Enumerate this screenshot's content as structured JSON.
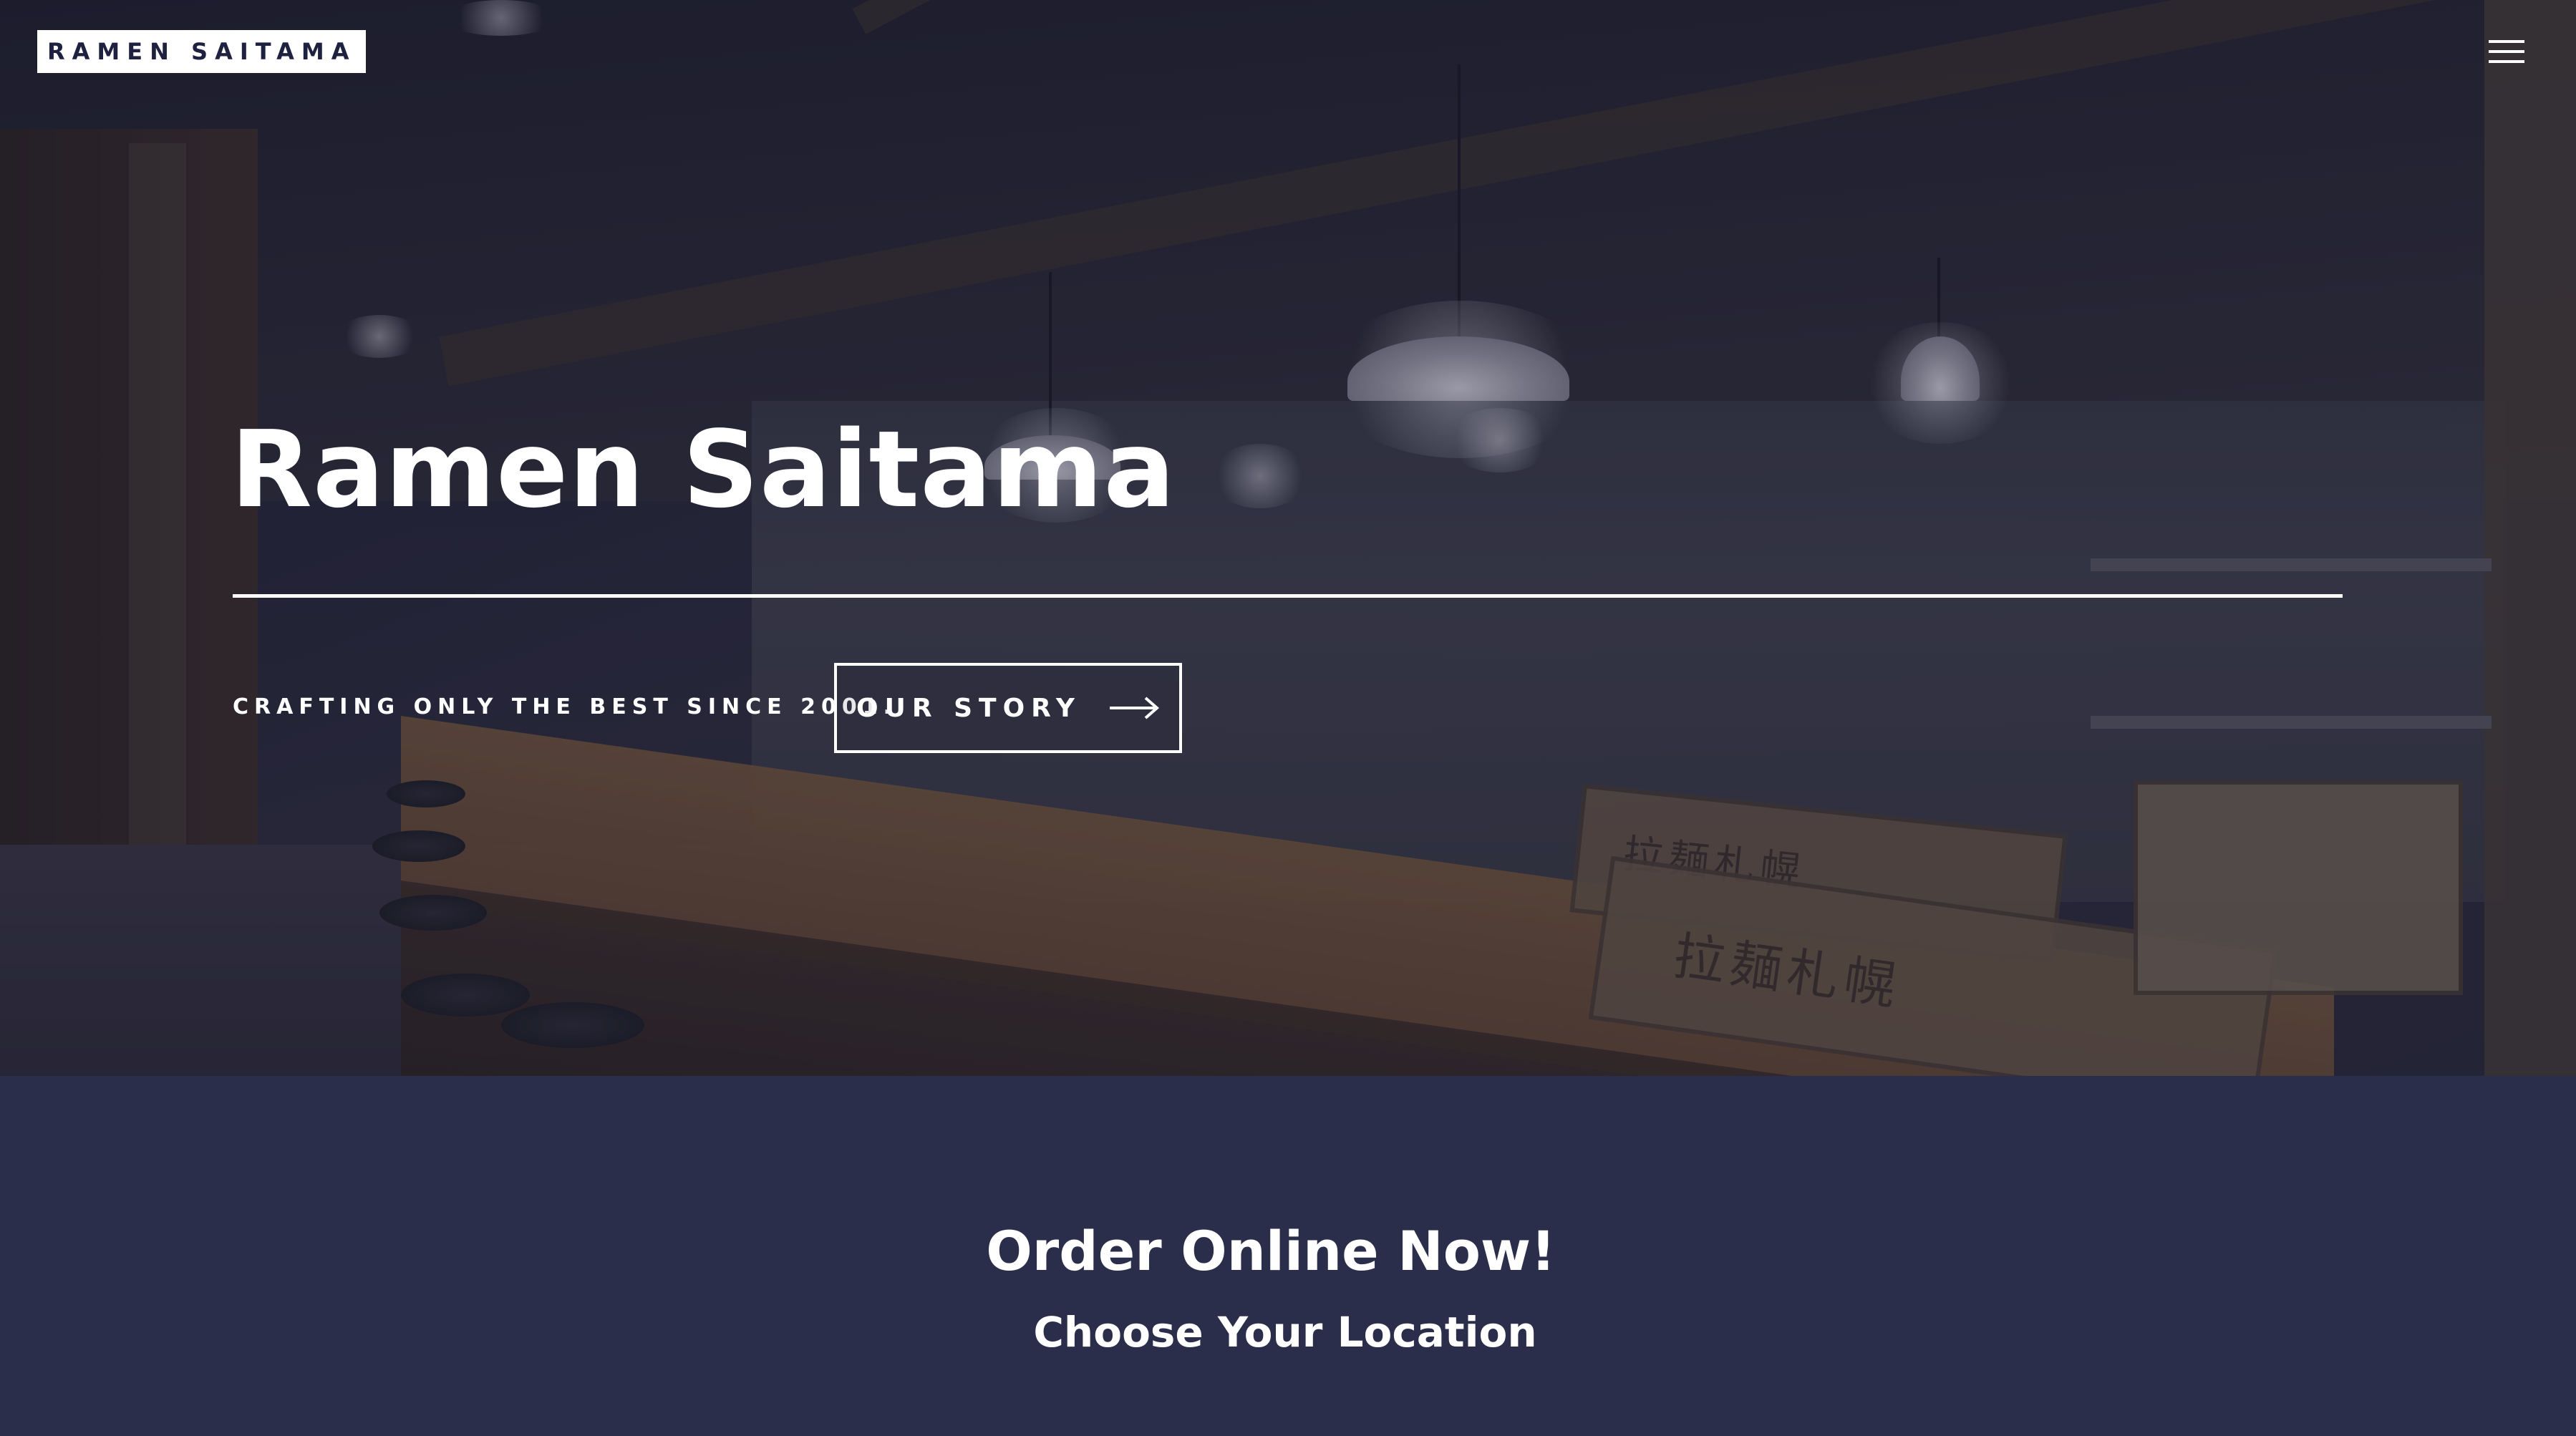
{
  "header": {
    "logo_text": "RAMEN SAITAMA",
    "menu_icon": "hamburger-menu-icon"
  },
  "hero": {
    "title": "Ramen Saitama",
    "tagline": "CRAFTING ONLY THE BEST SINCE 2001.",
    "story_button": {
      "label": "OUR STORY",
      "icon": "arrow-right-icon"
    },
    "crate_text": [
      "拉麺札幌",
      "拉麺札幌"
    ]
  },
  "order": {
    "title": "Order Online Now!",
    "subtitle": "Choose Your Location"
  },
  "colors": {
    "logo_background": "#ffffff",
    "logo_text": "#1f2140",
    "section_background": "#2b2e4b",
    "text": "#ffffff"
  }
}
